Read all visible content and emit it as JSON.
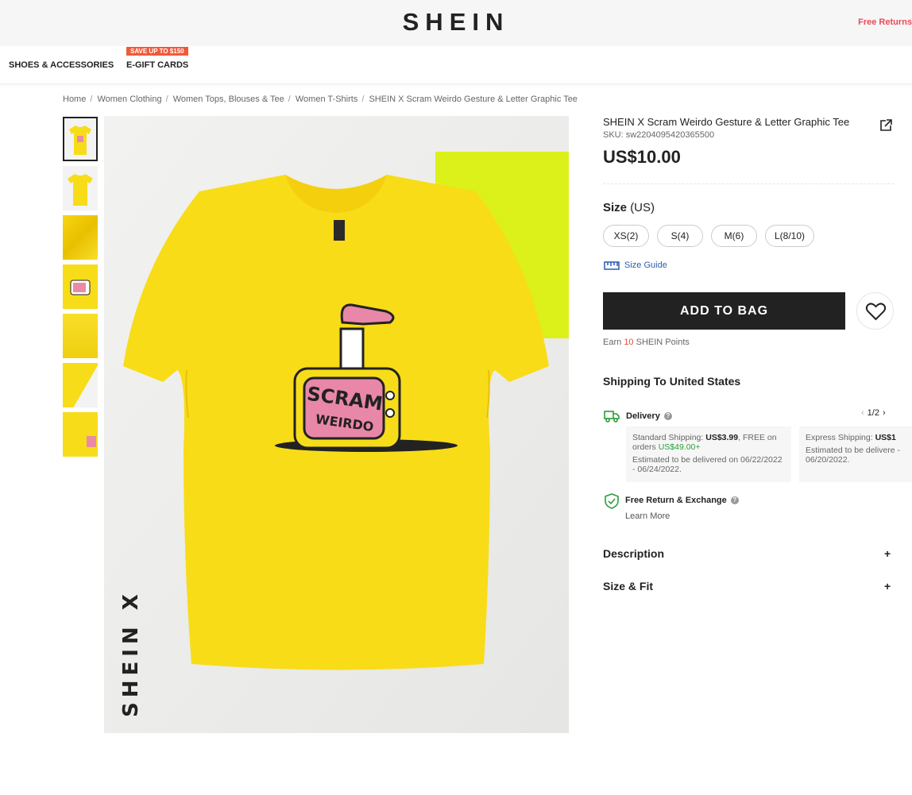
{
  "header": {
    "logo": "SHEIN",
    "free_returns": "Free Returns"
  },
  "nav": {
    "shoes": "SHOES & ACCESSORIES",
    "gift_badge": "SAVE UP TO $150",
    "gift": "E-GIFT CARDS"
  },
  "breadcrumb": [
    "Home",
    "Women Clothing",
    "Women Tops, Blouses & Tee",
    "Women T-Shirts",
    "SHEIN X Scram Weirdo Gesture & Letter Graphic Tee"
  ],
  "product": {
    "title": "SHEIN X Scram Weirdo Gesture & Letter Graphic Tee",
    "sku": "SKU: sw2204095420365500",
    "price": "US$10.00",
    "size_label": "Size",
    "size_unit": "(US)",
    "sizes": [
      "XS(2)",
      "S(4)",
      "M(6)",
      "L(8/10)"
    ],
    "size_guide": "Size Guide",
    "add_to_bag": "ADD TO BAG",
    "points_prefix": "Earn",
    "points_value": "10",
    "points_suffix": "SHEIN Points",
    "image_watermark": "SHEIN X",
    "print_text": "SCRAM WEIRDO"
  },
  "shipping": {
    "heading": "Shipping To United States",
    "pager": "1/2",
    "delivery": "Delivery",
    "standard_label": "Standard Shipping:",
    "standard_price": "US$3.99",
    "standard_free": ", FREE on orders",
    "standard_threshold": "US$49.00+",
    "standard_est": "Estimated to be delivered on 06/22/2022 - 06/24/2022.",
    "express_label": "Express Shipping:",
    "express_price": "US$1",
    "express_est": "Estimated to be delivere - 06/20/2022.",
    "free_return": "Free Return & Exchange",
    "learn_more": "Learn More"
  },
  "accordion": {
    "description": "Description",
    "size_fit": "Size & Fit",
    "plus": "+"
  },
  "colors": {
    "accent_red": "#e74a5a",
    "link_blue": "#2a5db0",
    "shirt_yellow": "#f5e21b",
    "green": "#2a9e3a"
  }
}
